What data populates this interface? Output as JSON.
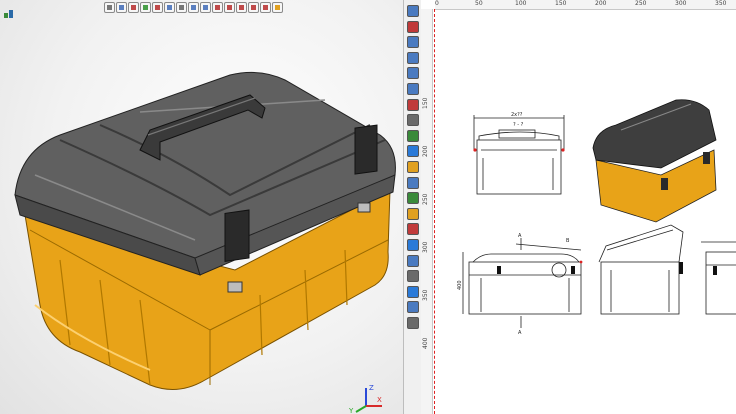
{
  "viewport": {
    "axis_labels": {
      "x": "X",
      "y": "Y",
      "z": "Z"
    },
    "colors": {
      "case_orange": "#e8a318",
      "lid_gray": "#5c5c5c",
      "background": "#f0f0f0"
    }
  },
  "toolbar": {
    "items": [
      {
        "name": "filter-icon"
      },
      {
        "name": "select-icon"
      },
      {
        "name": "edit-icon"
      },
      {
        "name": "measure-icon"
      },
      {
        "name": "cross-icon"
      },
      {
        "name": "box-select-icon"
      },
      {
        "name": "pointer-icon"
      },
      {
        "name": "point-icon"
      },
      {
        "name": "view-icon"
      },
      {
        "name": "view2-icon"
      },
      {
        "name": "view3-icon"
      },
      {
        "name": "view4-icon"
      },
      {
        "name": "view5-icon"
      },
      {
        "name": "view6-icon"
      },
      {
        "name": "color-icon"
      }
    ]
  },
  "vertical_toolbar": {
    "items": [
      {
        "name": "grid-icon"
      },
      {
        "name": "magnet-icon"
      },
      {
        "name": "zoom-in-icon"
      },
      {
        "name": "zoom-window-icon"
      },
      {
        "name": "zoom-out-icon"
      },
      {
        "name": "zoom-fit-icon"
      },
      {
        "name": "rotate-icon"
      },
      {
        "name": "pan-icon"
      },
      {
        "name": "section-icon"
      },
      {
        "name": "cube-icon"
      },
      {
        "name": "shading-icon"
      },
      {
        "name": "wireframe-icon"
      },
      {
        "name": "hidden-line-icon"
      },
      {
        "name": "render-icon"
      },
      {
        "name": "light-icon"
      },
      {
        "name": "orient-icon"
      },
      {
        "name": "display-icon"
      },
      {
        "name": "properties-icon"
      },
      {
        "name": "camera-icon"
      },
      {
        "name": "plane-icon"
      },
      {
        "name": "layer-icon"
      }
    ]
  },
  "ruler": {
    "top_labels": [
      "0",
      "50",
      "100",
      "150",
      "200",
      "250",
      "300",
      "350"
    ],
    "left_labels": [
      "150",
      "200",
      "250",
      "300",
      "350",
      "400"
    ]
  },
  "drawing": {
    "dim_top": "2x??",
    "dim_top_sub": "? - ?",
    "section_a_top": "A",
    "section_a_bottom": "A",
    "detail_b": "B",
    "dim_side": "400",
    "colors": {
      "line": "#222222",
      "accent": "#d22222"
    }
  }
}
